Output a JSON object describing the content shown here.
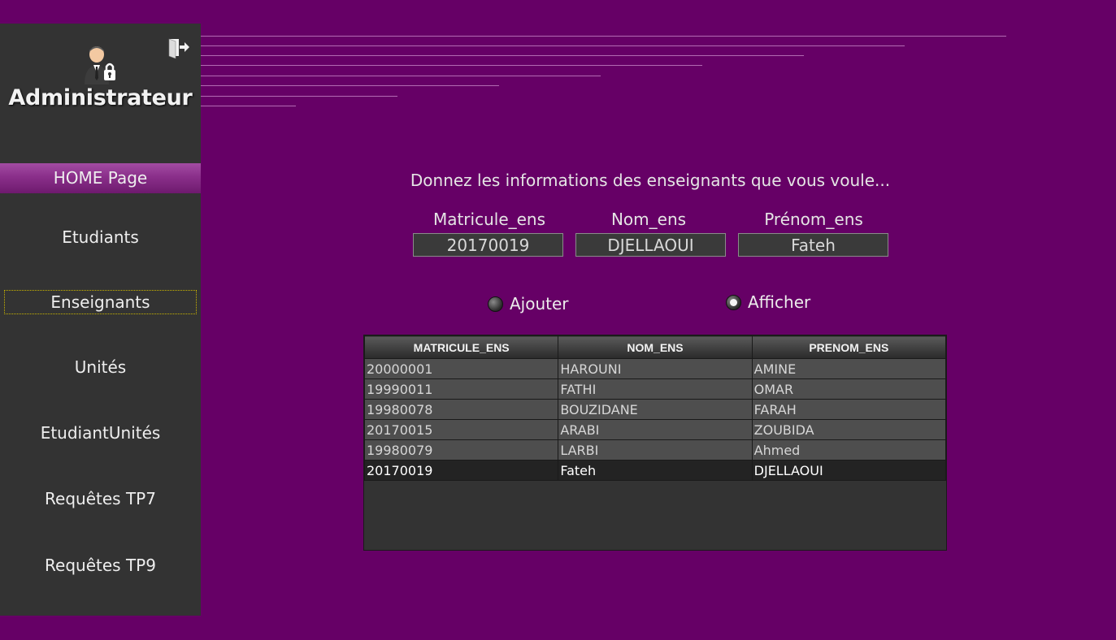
{
  "sidebar": {
    "title": "Administrateur",
    "nav": {
      "home": "HOME Page",
      "etudiants": "Etudiants",
      "enseignants": "Enseignants",
      "unites": "Unités",
      "etudiantunites": "EtudiantUnités",
      "tp7": "Requêtes TP7",
      "tp9": "Requêtes TP9"
    }
  },
  "form": {
    "prompt": "Donnez les informations des enseignants que vous voule...",
    "labels": {
      "matricule": "Matricule_ens",
      "nom": "Nom_ens",
      "prenom": "Prénom_ens"
    },
    "values": {
      "matricule": "20170019",
      "nom": "DJELLAOUI",
      "prenom": "Fateh"
    },
    "radios": {
      "ajouter": "Ajouter",
      "afficher": "Afficher",
      "selected": "afficher"
    }
  },
  "table": {
    "headers": {
      "matricule": "MATRICULE_ENS",
      "nom": "NOM_ENS",
      "prenom": "PRENOM_ENS"
    },
    "rows": [
      {
        "matricule": "20000001",
        "nom": "HAROUNI",
        "prenom": "AMINE"
      },
      {
        "matricule": "19990011",
        "nom": "FATHI",
        "prenom": "OMAR"
      },
      {
        "matricule": "19980078",
        "nom": "BOUZIDANE",
        "prenom": "FARAH"
      },
      {
        "matricule": "20170015",
        "nom": "ARABI",
        "prenom": "ZOUBIDA"
      },
      {
        "matricule": "19980079",
        "nom": "LARBI",
        "prenom": "Ahmed"
      },
      {
        "matricule": "20170019",
        "nom": "Fateh",
        "prenom": "DJELLAOUI"
      }
    ]
  }
}
